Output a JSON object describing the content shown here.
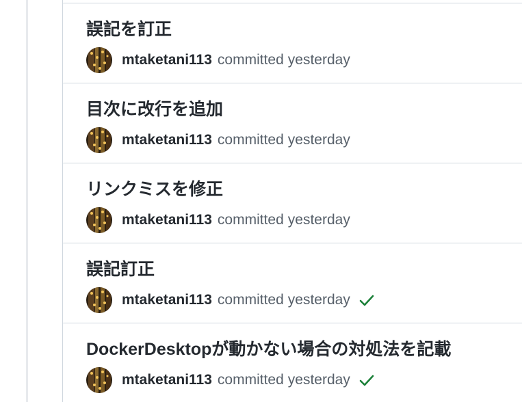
{
  "commits": [
    {
      "title": "誤記を訂正",
      "author": "mtaketani113",
      "action": "committed",
      "time": "yesterday",
      "status": "none"
    },
    {
      "title": "目次に改行を追加",
      "author": "mtaketani113",
      "action": "committed",
      "time": "yesterday",
      "status": "none"
    },
    {
      "title": "リンクミスを修正",
      "author": "mtaketani113",
      "action": "committed",
      "time": "yesterday",
      "status": "none"
    },
    {
      "title": "誤記訂正",
      "author": "mtaketani113",
      "action": "committed",
      "time": "yesterday",
      "status": "success"
    },
    {
      "title": "DockerDesktopが動かない場合の対処法を記載",
      "author": "mtaketani113",
      "action": "committed",
      "time": "yesterday",
      "status": "success"
    }
  ],
  "colors": {
    "title": "#24292f",
    "muted": "#57606a",
    "border": "#d0d7de",
    "success": "#1a7f37",
    "timeline": "#e8eaed"
  },
  "icons": {
    "avatar": "avatar-image",
    "status_success": "check-icon"
  }
}
